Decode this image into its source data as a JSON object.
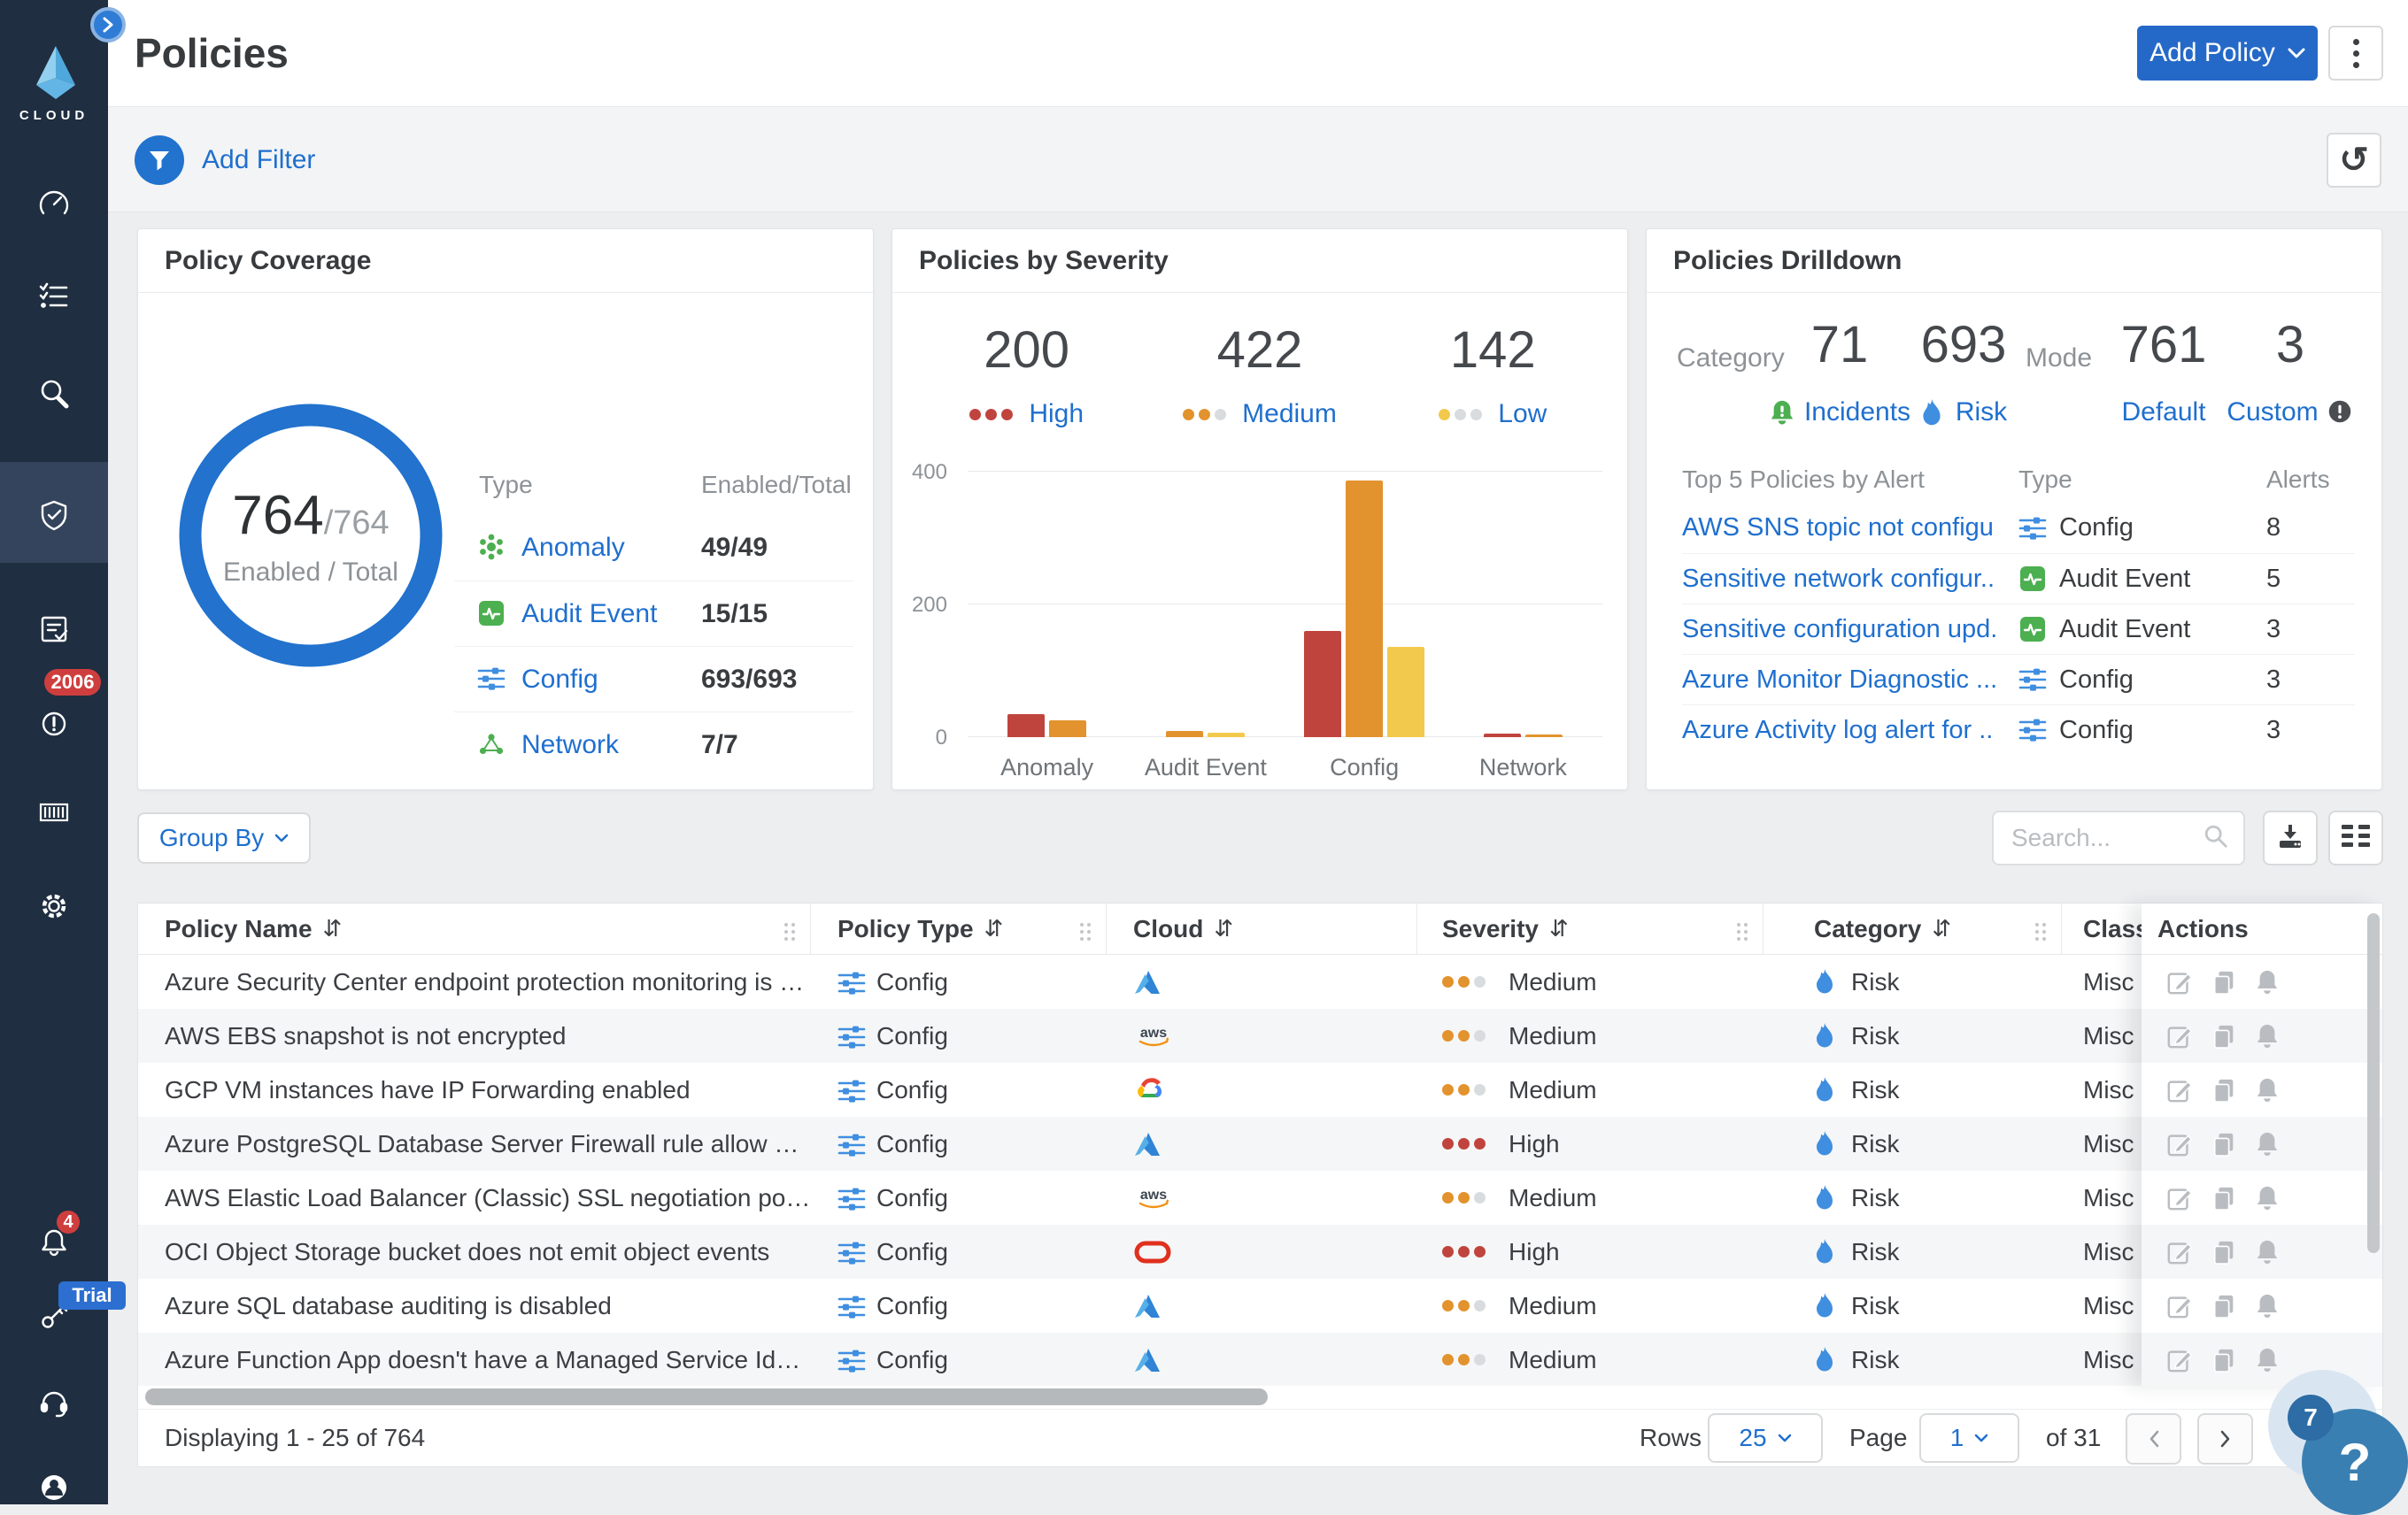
{
  "brand": {
    "logo_text": "CLOUD"
  },
  "sidebar": {
    "items": [
      {
        "icon": "dashboard-gauge-icon"
      },
      {
        "icon": "checklist-icon"
      },
      {
        "icon": "search-investigate-icon"
      },
      {
        "icon": "shield-policies-icon",
        "active": true
      },
      {
        "icon": "compliance-clipboard-icon"
      },
      {
        "icon": "alerts-circle-icon",
        "badge": "2006"
      },
      {
        "icon": "container-icon"
      },
      {
        "icon": "settings-gear-icon"
      },
      {
        "icon": "notification-bell-icon",
        "badge": "4"
      },
      {
        "icon": "keys-icon",
        "badge": "Trial"
      },
      {
        "icon": "support-headset-icon"
      },
      {
        "icon": "user-avatar-icon"
      }
    ],
    "trial_label": "Trial",
    "alerts_badge": "2006",
    "bell_badge": "4"
  },
  "header": {
    "title": "Policies",
    "add_policy_label": "Add Policy"
  },
  "filterbar": {
    "add_filter_label": "Add Filter"
  },
  "coverage": {
    "title": "Policy Coverage",
    "donut": {
      "enabled": "764",
      "total_suffix": "/764",
      "caption": "Enabled / Total",
      "ring_color": "#2272ce"
    },
    "type_header": "Type",
    "enabled_header": "Enabled/Total",
    "rows": [
      {
        "icon": "anomaly-icon",
        "label": "Anomaly",
        "value": "49/49"
      },
      {
        "icon": "audit-event-icon",
        "label": "Audit Event",
        "value": "15/15"
      },
      {
        "icon": "config-icon",
        "label": "Config",
        "value": "693/693"
      },
      {
        "icon": "network-icon",
        "label": "Network",
        "value": "7/7"
      }
    ]
  },
  "severity_card": {
    "title": "Policies by Severity",
    "stats": [
      {
        "value": "200",
        "label": "High",
        "dots_filled": 3,
        "dot_color": "#c0443e"
      },
      {
        "value": "422",
        "label": "Medium",
        "dots_filled": 2,
        "dot_color": "#e2932e"
      },
      {
        "value": "142",
        "label": "Low",
        "dots_filled": 1,
        "dot_color": "#f2c94c"
      }
    ],
    "empty_dot_color": "#d9dcde"
  },
  "chart_data": {
    "type": "bar",
    "title": "Policies by Severity",
    "categories": [
      "Anomaly",
      "Audit Event",
      "Config",
      "Network"
    ],
    "series": [
      {
        "name": "High",
        "color": "#c0443e",
        "values": [
          35,
          0,
          160,
          5
        ]
      },
      {
        "name": "Medium",
        "color": "#e2932e",
        "values": [
          25,
          9,
          386,
          2
        ]
      },
      {
        "name": "Low",
        "color": "#f2c94c",
        "values": [
          0,
          6,
          136,
          0
        ]
      }
    ],
    "totals": {
      "High": 200,
      "Medium": 422,
      "Low": 142
    },
    "ylim": [
      0,
      400
    ],
    "yticks": [
      400,
      200,
      0
    ],
    "grid": true,
    "legend_position": "top-stats"
  },
  "drilldown": {
    "title": "Policies Drilldown",
    "category_label": "Category",
    "mode_label": "Mode",
    "stats": [
      {
        "value": "71",
        "label": "Incidents",
        "icon": "incident-bell-icon"
      },
      {
        "value": "693",
        "label": "Risk",
        "icon": "risk-flame-icon"
      },
      {
        "value": "761",
        "label": "Default",
        "icon": ""
      },
      {
        "value": "3",
        "label": "Custom",
        "icon": "info-icon"
      }
    ],
    "table": {
      "name_header": "Top 5 Policies by Alert",
      "type_header": "Type",
      "alerts_header": "Alerts",
      "rows": [
        {
          "name": "AWS SNS topic not configu...",
          "type": "Config",
          "type_icon": "config-icon",
          "alerts": "8"
        },
        {
          "name": "Sensitive network configur...",
          "type": "Audit Event",
          "type_icon": "audit-event-icon",
          "alerts": "5"
        },
        {
          "name": "Sensitive configuration upd...",
          "type": "Audit Event",
          "type_icon": "audit-event-icon",
          "alerts": "3"
        },
        {
          "name": "Azure Monitor Diagnostic ...",
          "type": "Config",
          "type_icon": "config-icon",
          "alerts": "3"
        },
        {
          "name": "Azure Activity log alert for ...",
          "type": "Config",
          "type_icon": "config-icon",
          "alerts": "3"
        }
      ]
    }
  },
  "toolbar": {
    "group_by_label": "Group By",
    "search_placeholder": "Search..."
  },
  "policies_table": {
    "columns": [
      "Policy Name",
      "Policy Type",
      "Cloud",
      "Severity",
      "Category",
      "Class",
      "Actions"
    ],
    "rows": [
      {
        "name": "Azure Security Center endpoint protection monitoring is set to disab...",
        "type": "Config",
        "cloud": "azure",
        "severity": "Medium",
        "category": "Risk",
        "class": "Misc"
      },
      {
        "name": "AWS EBS snapshot is not encrypted",
        "type": "Config",
        "cloud": "aws",
        "severity": "Medium",
        "category": "Risk",
        "class": "Misc"
      },
      {
        "name": "GCP VM instances have IP Forwarding enabled",
        "type": "Config",
        "cloud": "gcp",
        "severity": "Medium",
        "category": "Risk",
        "class": "Misc"
      },
      {
        "name": "Azure PostgreSQL Database Server Firewall rule allow access to all I...",
        "type": "Config",
        "cloud": "azure",
        "severity": "High",
        "category": "Risk",
        "class": "Misc"
      },
      {
        "name": "AWS Elastic Load Balancer (Classic) SSL negotiation policy configure...",
        "type": "Config",
        "cloud": "aws",
        "severity": "Medium",
        "category": "Risk",
        "class": "Misc"
      },
      {
        "name": "OCI Object Storage bucket does not emit object events",
        "type": "Config",
        "cloud": "oci",
        "severity": "High",
        "category": "Risk",
        "class": "Misc"
      },
      {
        "name": "Azure SQL database auditing is disabled",
        "type": "Config",
        "cloud": "azure",
        "severity": "Medium",
        "category": "Risk",
        "class": "Misc"
      },
      {
        "name": "Azure Function App doesn't have a Managed Service Identity",
        "type": "Config",
        "cloud": "azure",
        "severity": "Medium",
        "category": "Risk",
        "class": "Misc"
      }
    ],
    "severity_colors": {
      "High": "#c0443e",
      "Medium": "#e2932e",
      "Low": "#f2c94c"
    },
    "empty_dot_color": "#d9dcde"
  },
  "pagination": {
    "displaying": "Displaying 1 - 25 of 764",
    "rows_label": "Rows",
    "rows_value": "25",
    "page_label": "Page",
    "page_value": "1",
    "total_label": "of 31"
  },
  "help": {
    "badge": "7",
    "question": "?"
  }
}
